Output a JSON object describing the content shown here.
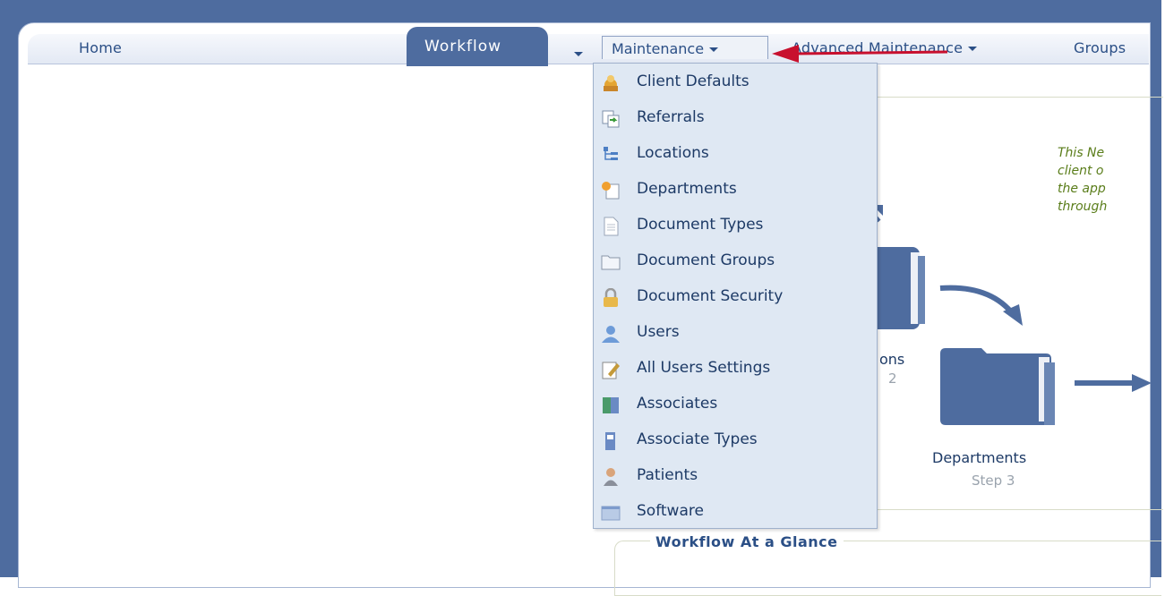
{
  "nav": {
    "home": "Home",
    "workflow": "Workflow",
    "maintenance": "Maintenance",
    "advanced_maintenance": "Advanced Maintenance",
    "groups": "Groups"
  },
  "menu": {
    "items": [
      {
        "label": "Client Defaults",
        "icon": "client-defaults-icon"
      },
      {
        "label": "Referrals",
        "icon": "referrals-icon"
      },
      {
        "label": "Locations",
        "icon": "locations-icon"
      },
      {
        "label": "Departments",
        "icon": "departments-icon"
      },
      {
        "label": "Document Types",
        "icon": "document-types-icon"
      },
      {
        "label": "Document Groups",
        "icon": "document-groups-icon"
      },
      {
        "label": "Document Security",
        "icon": "lock-icon"
      },
      {
        "label": "Users",
        "icon": "user-icon"
      },
      {
        "label": "All Users Settings",
        "icon": "settings-icon"
      },
      {
        "label": "Associates",
        "icon": "associates-icon"
      },
      {
        "label": "Associate Types",
        "icon": "associate-types-icon"
      },
      {
        "label": "Patients",
        "icon": "patient-icon"
      },
      {
        "label": "Software",
        "icon": "software-icon"
      }
    ]
  },
  "content": {
    "description": "This Ne\nclient o\nthe app\nthrough",
    "step2_title_fragment": "ons",
    "step2_sub_fragment": "2",
    "step3_title": "Departments",
    "step3_sub": "Step 3",
    "glance_title": "Workflow At a Glance"
  },
  "colors": {
    "frame": "#4e6c9f",
    "menu_bg": "#dfe8f3",
    "link": "#2b4f86",
    "annotation": "#c8102e",
    "description_text": "#5a7d1a"
  }
}
